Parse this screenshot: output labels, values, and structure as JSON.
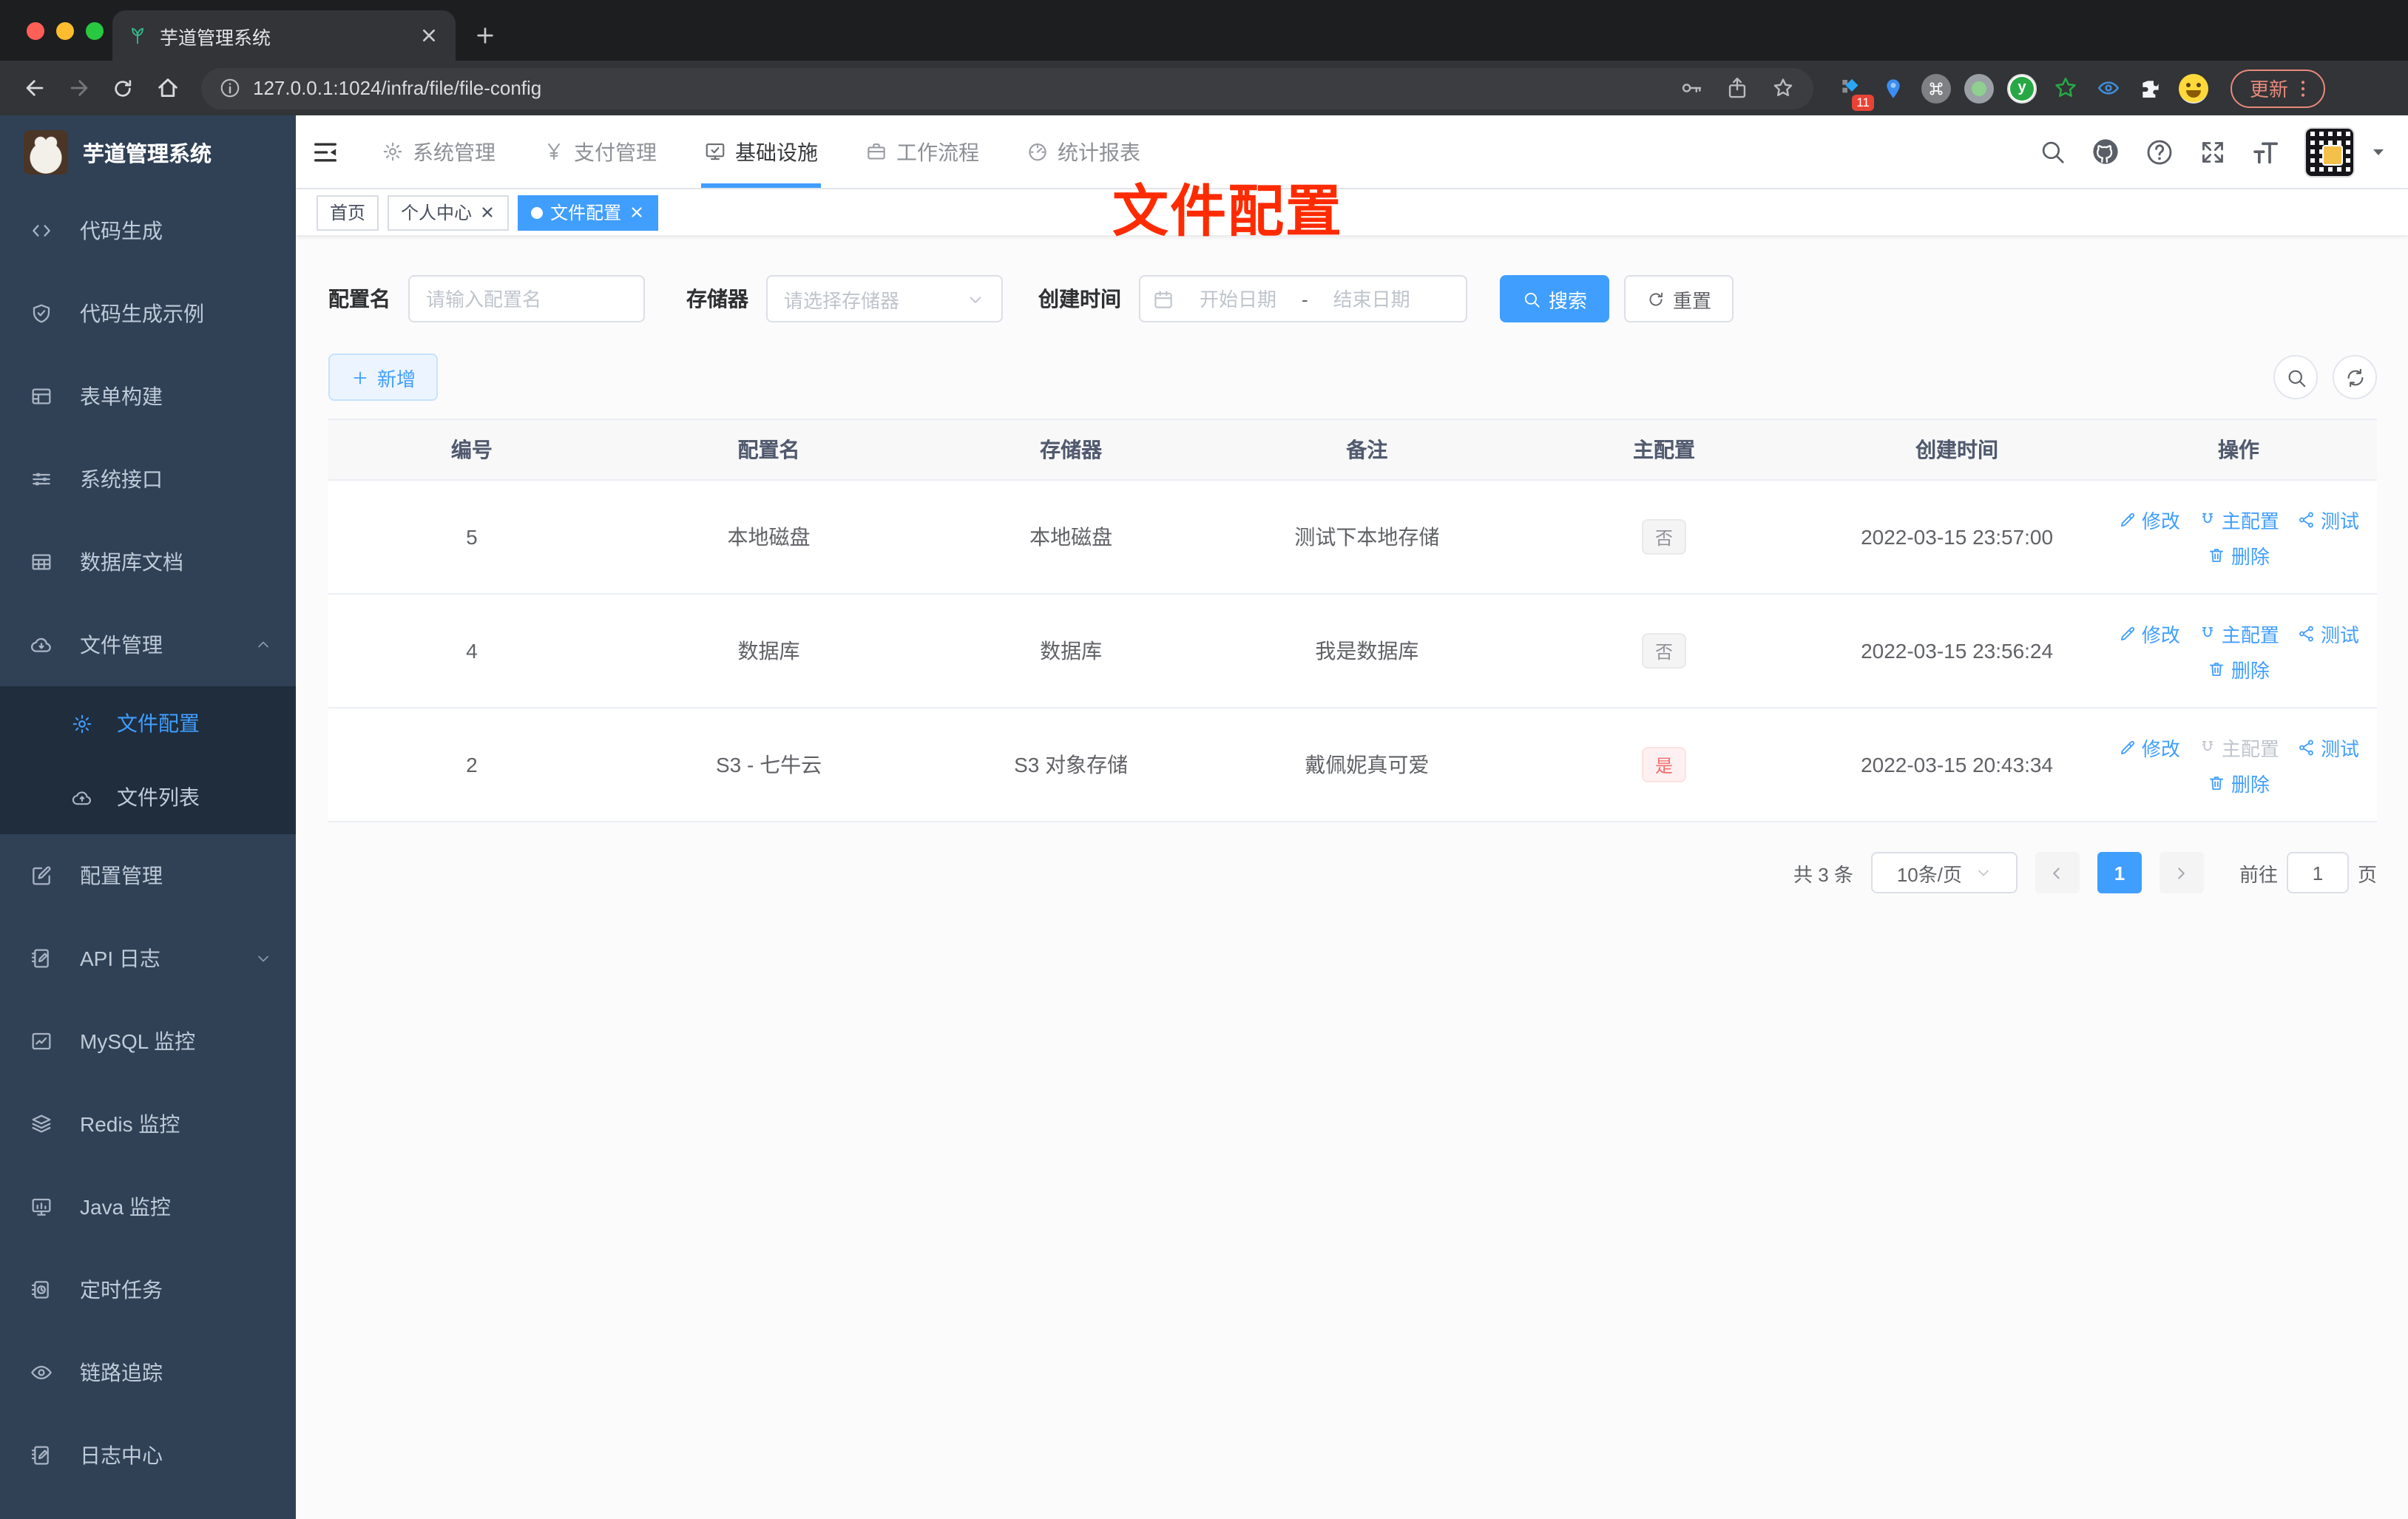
{
  "browser": {
    "tab_title": "芋道管理系统",
    "url": "127.0.0.1:1024/infra/file/file-config",
    "update_label": "更新",
    "extensions": [
      {
        "name": "diamond-extension",
        "badge": "11"
      },
      {
        "name": "pin-extension"
      },
      {
        "name": "command-extension"
      },
      {
        "name": "dot-extension"
      },
      {
        "name": "y-extension",
        "letter": "y"
      },
      {
        "name": "star-extension"
      },
      {
        "name": "eye-extension"
      },
      {
        "name": "puzzle-extension"
      },
      {
        "name": "emoji-extension"
      }
    ]
  },
  "sidebar": {
    "logo_title": "芋道管理系统",
    "items": [
      {
        "label": "代码生成",
        "icon": "code"
      },
      {
        "label": "代码生成示例",
        "icon": "shield"
      },
      {
        "label": "表单构建",
        "icon": "form"
      },
      {
        "label": "系统接口",
        "icon": "sliders"
      },
      {
        "label": "数据库文档",
        "icon": "grid"
      },
      {
        "label": "文件管理",
        "icon": "cloudDown",
        "expand": "up",
        "children": [
          {
            "label": "文件配置",
            "icon": "gear",
            "active": true
          },
          {
            "label": "文件列表",
            "icon": "cloudUp"
          }
        ]
      },
      {
        "label": "配置管理",
        "icon": "editSquare"
      },
      {
        "label": "API 日志",
        "icon": "noteEdit",
        "expand": "down"
      },
      {
        "label": "MySQL 监控",
        "icon": "chartBox"
      },
      {
        "label": "Redis 监控",
        "icon": "layers"
      },
      {
        "label": "Java 监控",
        "icon": "monitor"
      },
      {
        "label": "定时任务",
        "icon": "schedule"
      },
      {
        "label": "链路追踪",
        "icon": "eye"
      },
      {
        "label": "日志中心",
        "icon": "noteEdit"
      }
    ]
  },
  "topnav": {
    "items": [
      {
        "label": "系统管理",
        "icon": "gear"
      },
      {
        "label": "支付管理",
        "icon": "yen"
      },
      {
        "label": "基础设施",
        "icon": "infra",
        "active": true
      },
      {
        "label": "工作流程",
        "icon": "briefcase"
      },
      {
        "label": "统计报表",
        "icon": "gauge"
      }
    ]
  },
  "tags": {
    "items": [
      {
        "label": "首页"
      },
      {
        "label": "个人中心",
        "closable": true
      },
      {
        "label": "文件配置",
        "closable": true,
        "active": true
      }
    ]
  },
  "annotation": {
    "text": "文件配置",
    "color": "#ff2b00"
  },
  "filters": {
    "name_label": "配置名",
    "name_placeholder": "请输入配置名",
    "storage_label": "存储器",
    "storage_placeholder": "请选择存储器",
    "date_label": "创建时间",
    "date_start_placeholder": "开始日期",
    "date_separator": "-",
    "date_end_placeholder": "结束日期",
    "search_label": "搜索",
    "reset_label": "重置"
  },
  "toolbar": {
    "add_label": "新增"
  },
  "table": {
    "headers": [
      "编号",
      "配置名",
      "存储器",
      "备注",
      "主配置",
      "创建时间",
      "操作"
    ],
    "actions": {
      "edit": "修改",
      "master": "主配置",
      "test": "测试",
      "delete": "删除"
    },
    "rows": [
      {
        "id": "5",
        "name": "本地磁盘",
        "storage": "本地磁盘",
        "remark": "测试下本地存储",
        "master": "否",
        "master_flag": false,
        "created": "2022-03-15 23:57:00"
      },
      {
        "id": "4",
        "name": "数据库",
        "storage": "数据库",
        "remark": "我是数据库",
        "master": "否",
        "master_flag": false,
        "created": "2022-03-15 23:56:24"
      },
      {
        "id": "2",
        "name": "S3 - 七牛云",
        "storage": "S3 对象存储",
        "remark": "戴佩妮真可爱",
        "master": "是",
        "master_flag": true,
        "created": "2022-03-15 20:43:34"
      }
    ]
  },
  "pagination": {
    "total_text": "共 3 条",
    "page_size": "10条/页",
    "current_page": "1",
    "goto_label": "前往",
    "goto_value": "1",
    "page_unit": "页"
  },
  "colors": {
    "accent": "#409eff",
    "danger": "#f56c6c",
    "annotation": "#ff2b00"
  }
}
